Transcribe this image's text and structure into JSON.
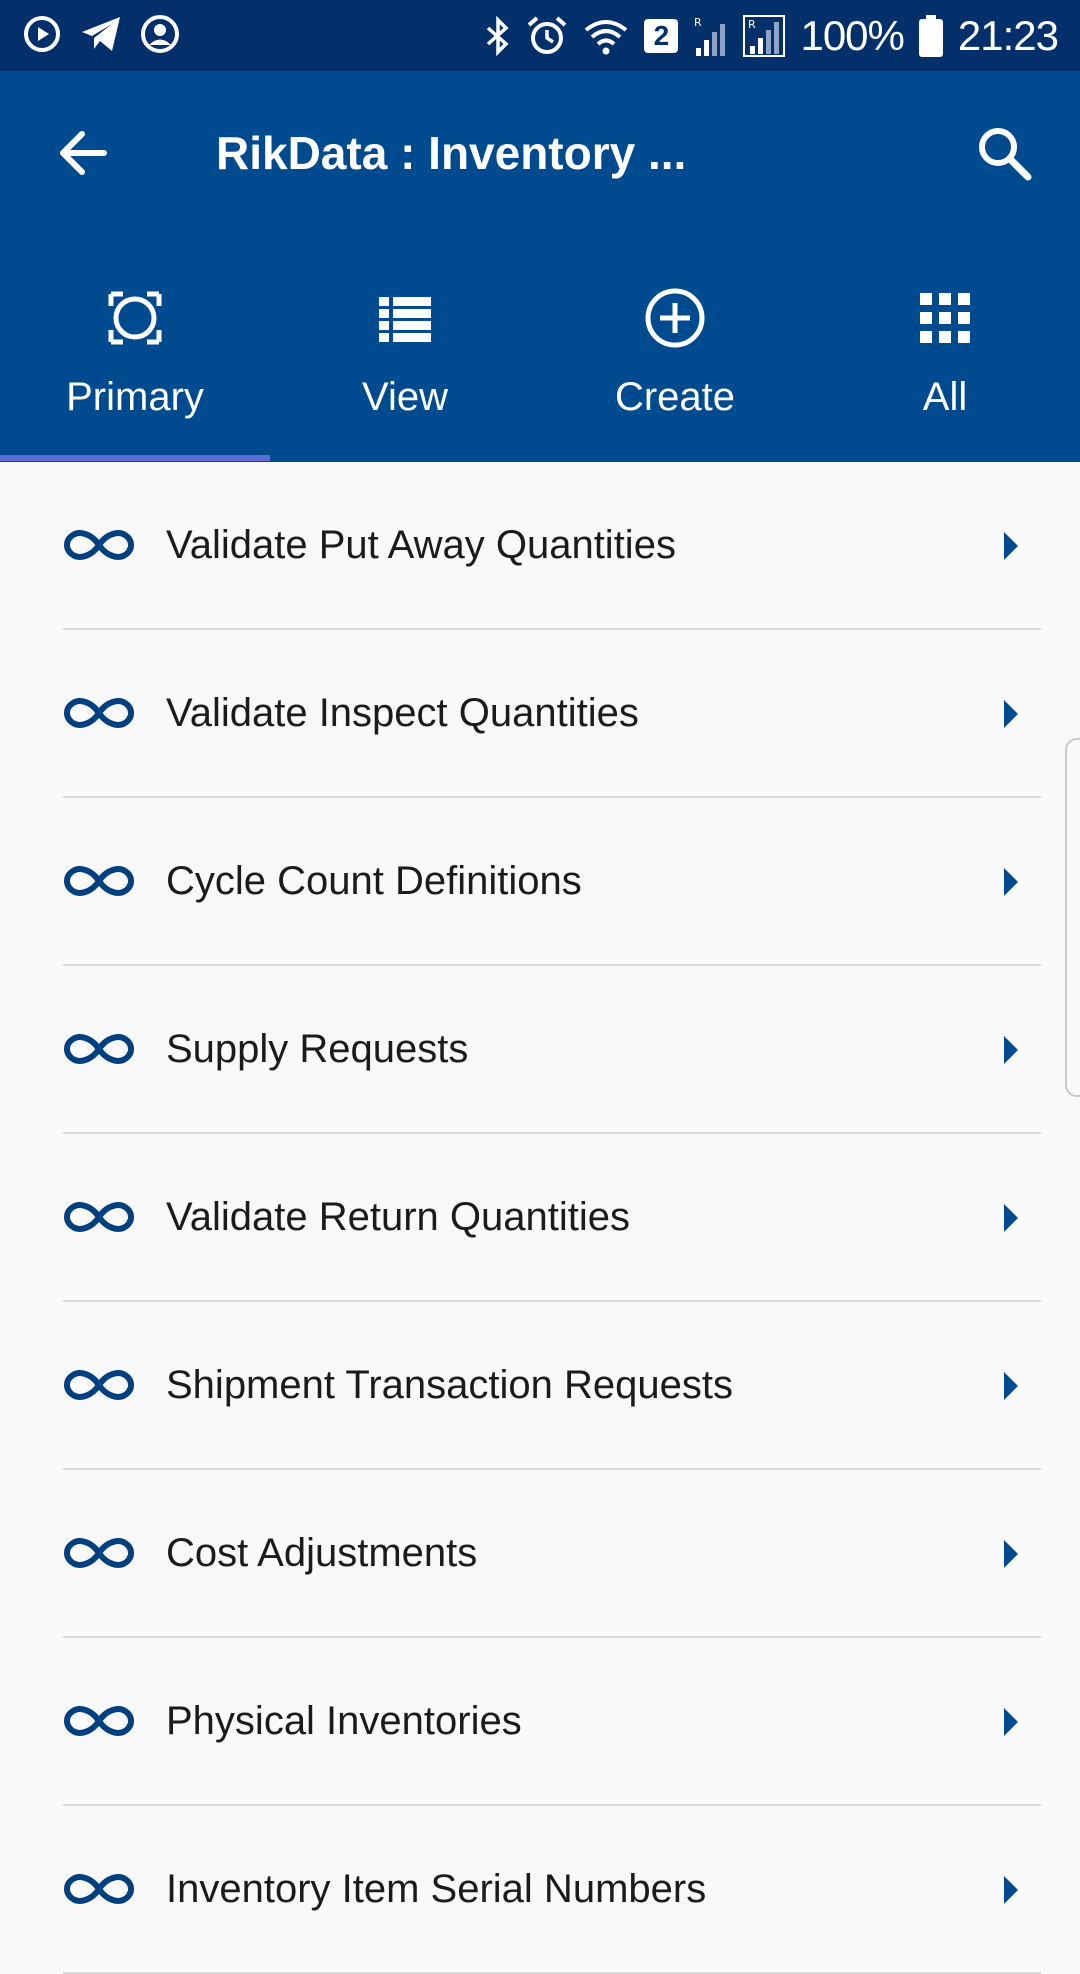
{
  "status_bar": {
    "battery": "100%",
    "time": "21:23",
    "sim_badge": "2",
    "colors": {
      "background": "#03306b",
      "foreground": "#ffffff"
    },
    "icons": [
      "media-icon",
      "telegram-icon",
      "account-icon",
      "bluetooth-icon",
      "alarm-icon",
      "wifi-icon",
      "signal-icon",
      "signal-icon",
      "battery-icon"
    ]
  },
  "app_bar": {
    "title": "RikData : Inventory ...",
    "back_icon": "arrow-left-icon",
    "search_icon": "search-icon",
    "color": "#004a8f"
  },
  "tabs": [
    {
      "label": "Primary",
      "icon": "primary-icon",
      "selected": true
    },
    {
      "label": "View",
      "icon": "list-icon",
      "selected": false
    },
    {
      "label": "Create",
      "icon": "plus-circle-icon",
      "selected": false
    },
    {
      "label": "All",
      "icon": "grid-icon",
      "selected": false
    }
  ],
  "indicator_color": "#5c6bd6",
  "list": {
    "item_icon": "infinity-icon",
    "chevron_icon": "chevron-right-icon",
    "items": [
      {
        "label": "Validate Put Away Quantities"
      },
      {
        "label": "Validate Inspect Quantities"
      },
      {
        "label": "Cycle Count Definitions"
      },
      {
        "label": "Supply Requests"
      },
      {
        "label": "Validate Return Quantities"
      },
      {
        "label": "Shipment Transaction Requests"
      },
      {
        "label": "Cost Adjustments"
      },
      {
        "label": "Physical Inventories"
      },
      {
        "label": "Inventory Item Serial Numbers"
      }
    ]
  }
}
